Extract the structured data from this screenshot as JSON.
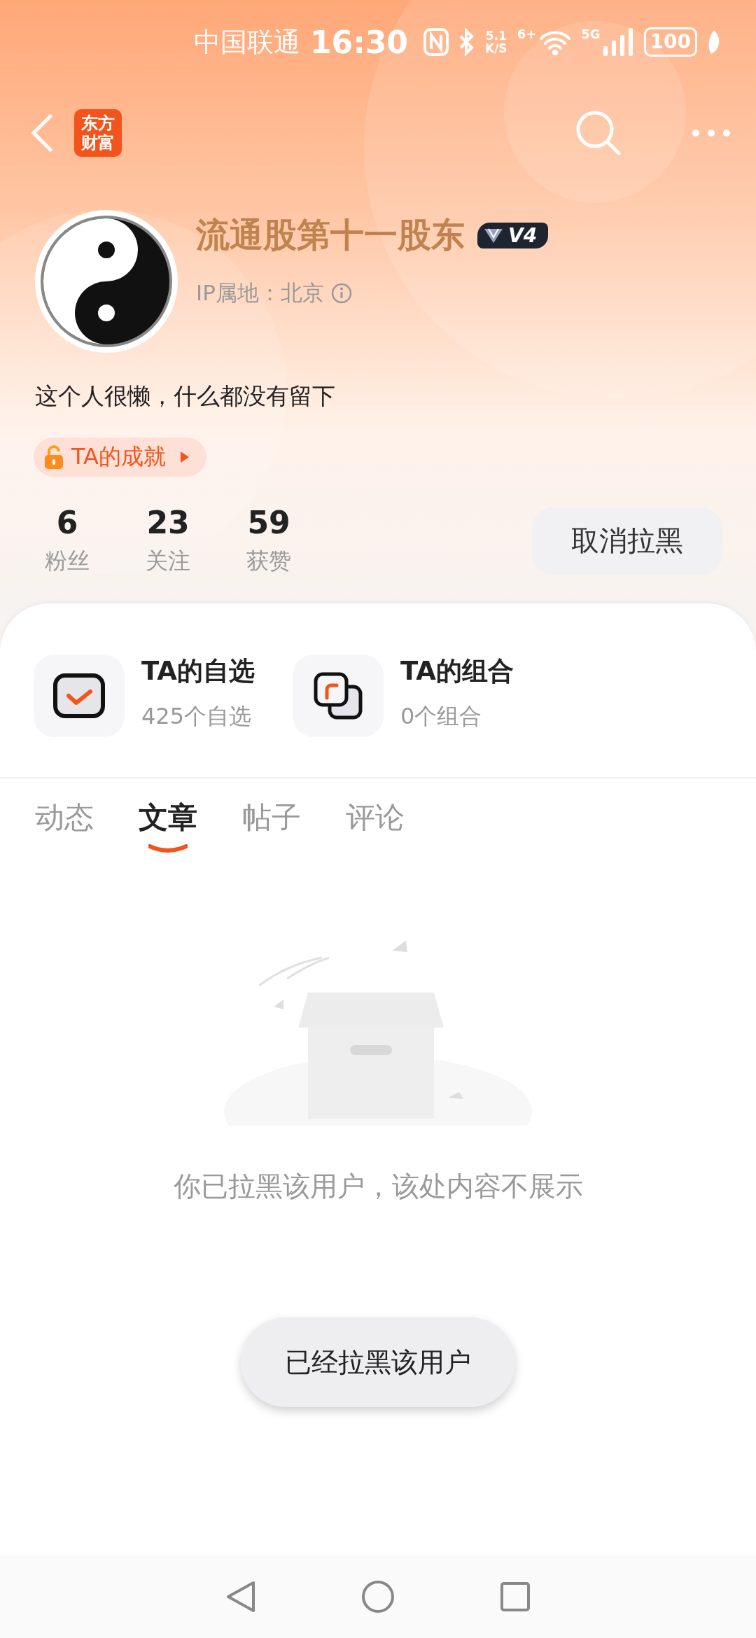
{
  "status_bar": {
    "carrier": "中国联通",
    "time": "16:30",
    "speed_value": "5.1",
    "speed_unit": "K/S",
    "wifi_tag": "6+",
    "network": "5G",
    "battery": "100"
  },
  "header": {
    "logo_lines": [
      "东方",
      "财富"
    ]
  },
  "profile": {
    "name": "流通股第十一股东",
    "level_badge": "V4",
    "ip_location": "IP属地：北京",
    "bio": "这个人很懒，什么都没有留下",
    "achievement": "TA的成就"
  },
  "stats": [
    {
      "value": "6",
      "label": "粉丝"
    },
    {
      "value": "23",
      "label": "关注"
    },
    {
      "value": "59",
      "label": "获赞"
    }
  ],
  "unblock_button": "取消拉黑",
  "shortcuts": [
    {
      "kind": "watchlist",
      "title": "TA的自选",
      "subtitle": "425个自选"
    },
    {
      "kind": "portfolio",
      "title": "TA的组合",
      "subtitle": "0个组合"
    }
  ],
  "tabs": [
    {
      "label": "动态",
      "selected": false
    },
    {
      "label": "文章",
      "selected": true
    },
    {
      "label": "帖子",
      "selected": false
    },
    {
      "label": "评论",
      "selected": false
    }
  ],
  "empty_state": {
    "message": "你已拉黑该用户，该处内容不展示"
  },
  "toast": "已经拉黑该用户"
}
